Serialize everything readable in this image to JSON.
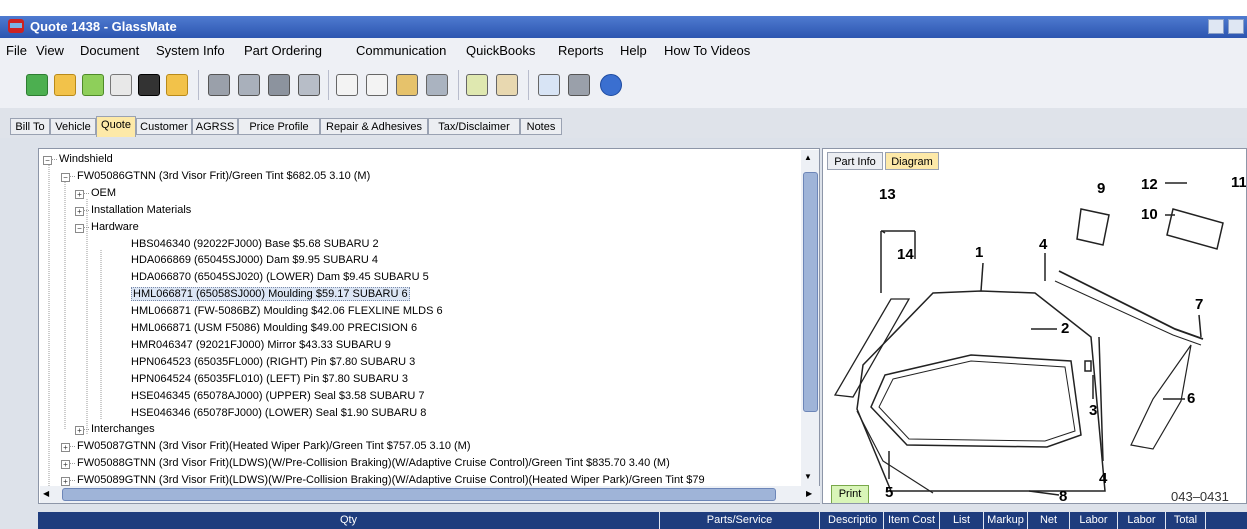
{
  "window": {
    "title": "Quote 1438 - GlassMate"
  },
  "menu": [
    "File",
    "View",
    "Document",
    "System Info",
    "Part Ordering",
    "Communication",
    "QuickBooks",
    "Reports",
    "Help",
    "How To Videos"
  ],
  "tabs": [
    "Bill To",
    "Vehicle",
    "Quote",
    "Customer",
    "AGRSS",
    "Price Profile",
    "Repair & Adhesives",
    "Tax/Disclaimer",
    "Notes"
  ],
  "active_tab": "Quote",
  "tree": [
    {
      "text": "Windshield",
      "exp": "minus"
    },
    {
      "text": "FW05086GTNN   (3rd Visor Frit)/Green Tint   $682.05   3.10   (M)",
      "exp": "minus"
    },
    {
      "text": "OEM",
      "exp": "plus"
    },
    {
      "text": "Installation Materials",
      "exp": "plus"
    },
    {
      "text": "Hardware",
      "exp": "minus"
    },
    {
      "text": "HBS046340  (92022FJ000)  Base  $5.68  SUBARU  2",
      "exp": ""
    },
    {
      "text": "HDA066869  (65045SJ000)  Dam  $9.95  SUBARU  4",
      "exp": ""
    },
    {
      "text": "HDA066870  (65045SJ020)  (LOWER)  Dam  $9.45  SUBARU  5",
      "exp": ""
    },
    {
      "text": "HML066871  (65058SJ000)  Moulding  $59.17  SUBARU  6",
      "exp": "",
      "selected": true
    },
    {
      "text": "HML066871  (FW-5086BZ)  Moulding  $42.06  FLEXLINE MLDS  6",
      "exp": ""
    },
    {
      "text": "HML066871  (USM F5086)  Moulding  $49.00  PRECISION  6",
      "exp": ""
    },
    {
      "text": "HMR046347  (92021FJ000)  Mirror  $43.33  SUBARU  9",
      "exp": ""
    },
    {
      "text": "HPN064523  (65035FL000)  (RIGHT)  Pin  $7.80  SUBARU  3",
      "exp": ""
    },
    {
      "text": "HPN064524  (65035FL010)  (LEFT)  Pin  $7.80  SUBARU  3",
      "exp": ""
    },
    {
      "text": "HSE046345  (65078AJ000)  (UPPER)  Seal  $3.58  SUBARU  7",
      "exp": ""
    },
    {
      "text": "HSE046346  (65078FJ000)  (LOWER)  Seal  $1.90  SUBARU  8",
      "exp": ""
    },
    {
      "text": "Interchanges",
      "exp": "plus"
    },
    {
      "text": "FW05087GTNN   (3rd Visor Frit)(Heated Wiper Park)/Green Tint   $757.05   3.10   (M)",
      "exp": "plus"
    },
    {
      "text": "FW05088GTNN   (3rd Visor Frit)(LDWS)(W/Pre-Collision Braking)(W/Adaptive Cruise Control)/Green Tint   $835.70   3.40   (M)",
      "exp": "plus"
    },
    {
      "text": "FW05089GTNN   (3rd Visor Frit)(LDWS)(W/Pre-Collision Braking)(W/Adaptive Cruise Control)(Heated Wiper Park)/Green Tint   $79",
      "exp": "plus"
    }
  ],
  "right_tabs": [
    "Part Info",
    "Diagram"
  ],
  "right_active": "Diagram",
  "print_label": "Print",
  "diagram": {
    "callouts": [
      "1",
      "2",
      "3",
      "4",
      "4",
      "5",
      "6",
      "7",
      "8",
      "9",
      "10",
      "11",
      "12",
      "13",
      "14"
    ],
    "code": "043–0431"
  },
  "columns": [
    "Qty",
    "Parts/Service",
    "Descriptio",
    "Item Cost",
    "List",
    "Markup",
    "Net",
    "Labor",
    "Labor",
    "Total"
  ],
  "colors": {
    "title_bar": "#3d67c4",
    "header_bar": "#1e3c7d",
    "active_tab": "#fde9a8"
  }
}
